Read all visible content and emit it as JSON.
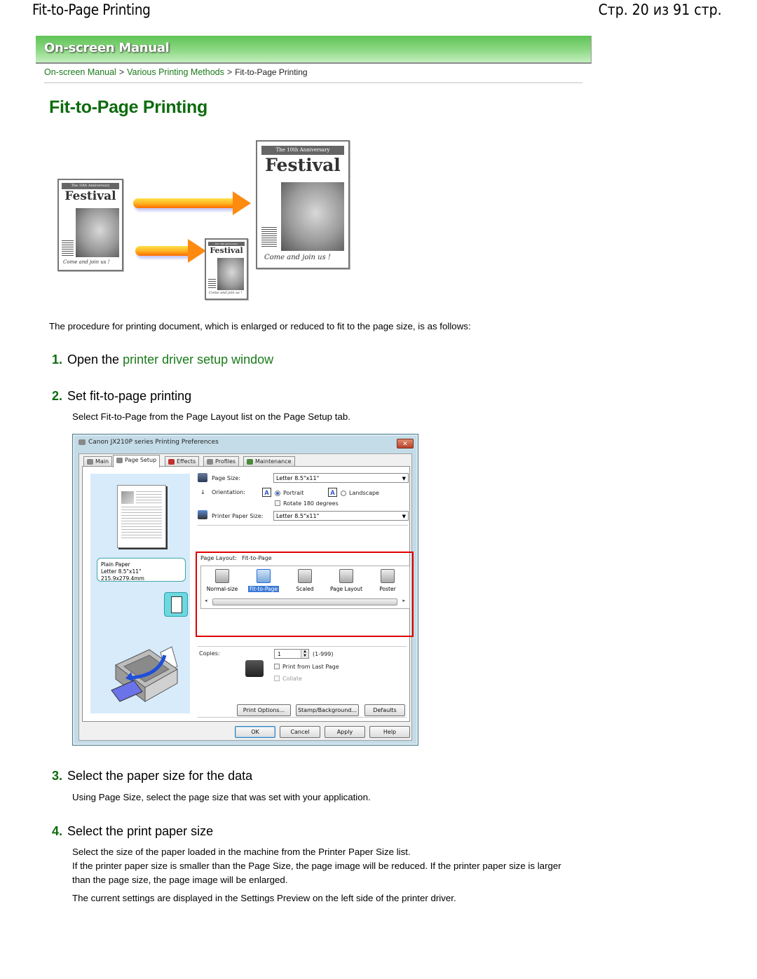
{
  "pdf_header": {
    "title": "Fit-to-Page Printing",
    "page_counter": "Стр. 20 из 91 стр."
  },
  "banner": {
    "title": "On-screen Manual"
  },
  "breadcrumb": {
    "items": [
      {
        "label": "On-screen Manual",
        "link": true
      },
      {
        "label": "Various Printing Methods",
        "link": true
      },
      {
        "label": "Fit-to-Page Printing",
        "link": false
      }
    ],
    "separator": ">"
  },
  "page_title": "Fit-to-Page Printing",
  "hero_illustration": {
    "poster_banner": "The 10th Anniversary",
    "poster_heading": "Festival",
    "poster_tagline": "Come and join us !"
  },
  "intro": "The procedure for printing document, which is enlarged or reduced to fit to the page size, is as follows:",
  "steps": [
    {
      "num": "1.",
      "text": "Open the ",
      "link": "printer driver setup window"
    },
    {
      "num": "2.",
      "text": "Set fit-to-page printing",
      "desc": "Select Fit-to-Page from the Page Layout list on the Page Setup tab."
    },
    {
      "num": "3.",
      "text": "Select the paper size for the data",
      "desc": "Using Page Size, select the page size that was set with your application."
    },
    {
      "num": "4.",
      "text": "Select the print paper size",
      "desc1": "Select the size of the paper loaded in the machine from the Printer Paper Size list.",
      "desc2": "If the printer paper size is smaller than the Page Size, the page image will be reduced. If the printer paper size is larger than the page size, the page image will be enlarged.",
      "desc3": "The current settings are displayed in the Settings Preview on the left side of the printer driver."
    }
  ],
  "dialog": {
    "title": "Canon JX210P series Printing Preferences",
    "close": "✕",
    "tabs": [
      "Main",
      "Page Setup",
      "Effects",
      "Profiles",
      "Maintenance"
    ],
    "active_tab": "Page Setup",
    "preview": {
      "media": "Plain Paper",
      "size": "Letter 8.5\"x11\" 215.9x279.4mm"
    },
    "page_size_label": "Page Size:",
    "page_size_value": "Letter 8.5\"x11\"",
    "orientation_label": "Orientation:",
    "orientation_options": [
      "Portrait",
      "Landscape"
    ],
    "orientation_selected": "Portrait",
    "rotate_label": "Rotate 180 degrees",
    "printer_paper_size_label": "Printer Paper Size:",
    "printer_paper_size_value": "Letter 8.5\"x11\"",
    "page_layout_label": "Page Layout:",
    "page_layout_value": "Fit-to-Page",
    "layouts": [
      "Normal-size",
      "Fit-to-Page",
      "Scaled",
      "Page Layout",
      "Poster"
    ],
    "layout_selected": "Fit-to-Page",
    "copies_label": "Copies:",
    "copies_value": "1",
    "copies_range": "(1-999)",
    "print_from_last_page": "Print from Last Page",
    "collate": "Collate",
    "buttons": {
      "print_options": "Print Options...",
      "stamp_background": "Stamp/Background...",
      "defaults": "Defaults",
      "ok": "OK",
      "cancel": "Cancel",
      "apply": "Apply",
      "help": "Help"
    },
    "highlight_color": "#e00000"
  },
  "colors": {
    "brand_green": "#0e6b0e",
    "link_green": "#1a7a1a"
  }
}
